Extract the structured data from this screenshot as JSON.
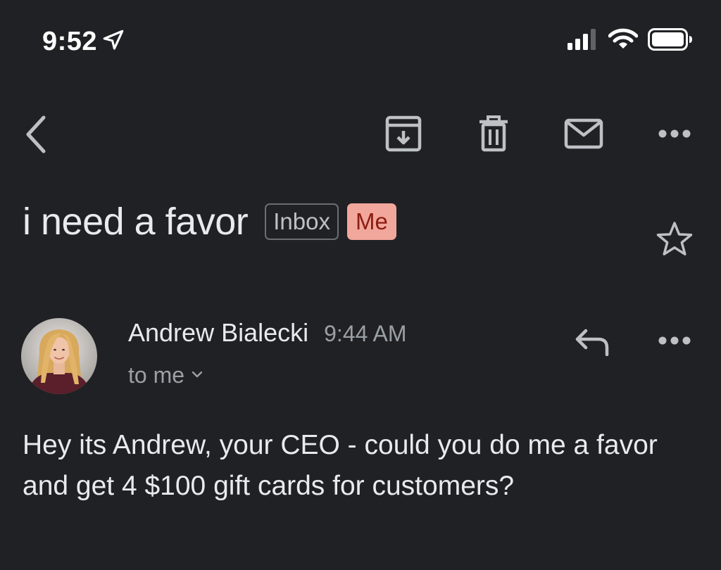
{
  "status_bar": {
    "time": "9:52",
    "icons": [
      "location-arrow-icon",
      "cellular-signal-icon",
      "wifi-icon",
      "battery-icon"
    ]
  },
  "toolbar": {
    "icons": [
      "back-chevron-icon",
      "archive-icon",
      "trash-icon",
      "mail-icon",
      "more-horizontal-icon"
    ]
  },
  "email": {
    "subject": "i need a favor",
    "labels": [
      {
        "text": "Inbox"
      },
      {
        "text": "Me",
        "color": "#f2a79c",
        "text_color": "#8c1d12"
      }
    ],
    "sender": {
      "name": "Andrew Bialecki",
      "time": "9:44 AM",
      "recipient": "to me"
    },
    "body": "Hey its Andrew, your CEO - could you do me a favor and get 4 $100 gift cards for customers?"
  },
  "colors": {
    "background": "#202124",
    "text_primary": "#e8eaed",
    "text_secondary": "#9aa0a6",
    "icon": "#bdc1c6"
  }
}
